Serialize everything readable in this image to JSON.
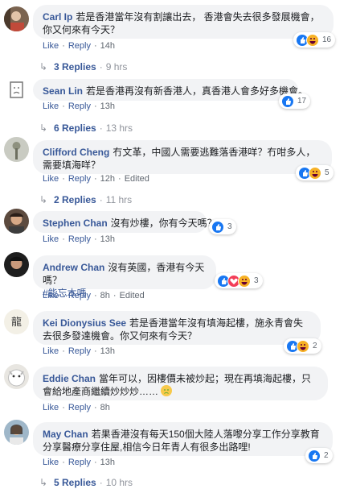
{
  "comments": [
    {
      "author": "Carl Ip",
      "text": "若是香港當年沒有割讓出去， 香港會失去很多發展機會，你又何來有今天？",
      "actions": {
        "like": "Like",
        "reply": "Reply",
        "time": "14h"
      },
      "reactions": {
        "icons": [
          "like",
          "haha"
        ],
        "count": "16"
      },
      "replies": {
        "label": "3 Replies",
        "time": "9 hrs"
      }
    },
    {
      "author": "Sean Lin",
      "text": "若是香港再沒有新香港人，真香港人會多好多機會。",
      "actions": {
        "like": "Like",
        "reply": "Reply",
        "time": "13h"
      },
      "reactions": {
        "icons": [
          "like"
        ],
        "count": "17"
      },
      "replies": {
        "label": "6 Replies",
        "time": "13 hrs"
      }
    },
    {
      "author": "Clifford Cheng",
      "text": "冇文革，中國人需要逃難落香港咩？冇咁多人，需要填海咩？",
      "actions": {
        "like": "Like",
        "reply": "Reply",
        "time": "12h",
        "edited": "Edited"
      },
      "reactions": {
        "icons": [
          "like",
          "haha"
        ],
        "count": "5"
      },
      "replies": {
        "label": "2 Replies",
        "time": "11 hrs"
      }
    },
    {
      "author": "Stephen Chan",
      "text": "沒有炒樓，你有今天嗎？",
      "actions": {
        "like": "Like",
        "reply": "Reply",
        "time": "13h"
      },
      "reactions": {
        "icons": [
          "like"
        ],
        "count": "3"
      }
    },
    {
      "author": "Andrew Chan",
      "text": "沒有英國，香港有今天嗎？",
      "hashtag": "#能忘本嗎",
      "actions": {
        "like": "Like",
        "reply": "Reply",
        "time": "8h",
        "edited": "Edited"
      },
      "reactions": {
        "icons": [
          "like",
          "love",
          "haha"
        ],
        "count": "3"
      }
    },
    {
      "author": "Kei Dionysius See",
      "text": "若是香港當年沒有填海起樓，施永青會失去很多發達機會。你又何來有今天？",
      "actions": {
        "like": "Like",
        "reply": "Reply",
        "time": "13h"
      },
      "reactions": {
        "icons": [
          "like",
          "haha"
        ],
        "count": "2"
      }
    },
    {
      "author": "Eddie Chan",
      "text": "當年可以，因樓價未被炒起；現在再填海起樓，只會給地產商繼續炒炒炒……",
      "emoji": "sad-face",
      "actions": {
        "like": "Like",
        "reply": "Reply",
        "time": "8h"
      }
    },
    {
      "author": "May Chan",
      "text": "若果香港沒有每天150個大陸人落嚟分享工作分享教育分享醫療分享住屋,相信今日年青人有很多出路哩!",
      "actions": {
        "like": "Like",
        "reply": "Reply",
        "time": "13h"
      },
      "reactions": {
        "icons": [
          "like"
        ],
        "count": "2"
      },
      "replies": {
        "label": "5 Replies",
        "time": "10 hrs"
      }
    }
  ],
  "colors": {
    "link": "#385898",
    "bubble": "#f2f3f5",
    "meta": "#606770",
    "like": "#1877f2",
    "haha": "#f7b125",
    "love": "#f33e58"
  }
}
